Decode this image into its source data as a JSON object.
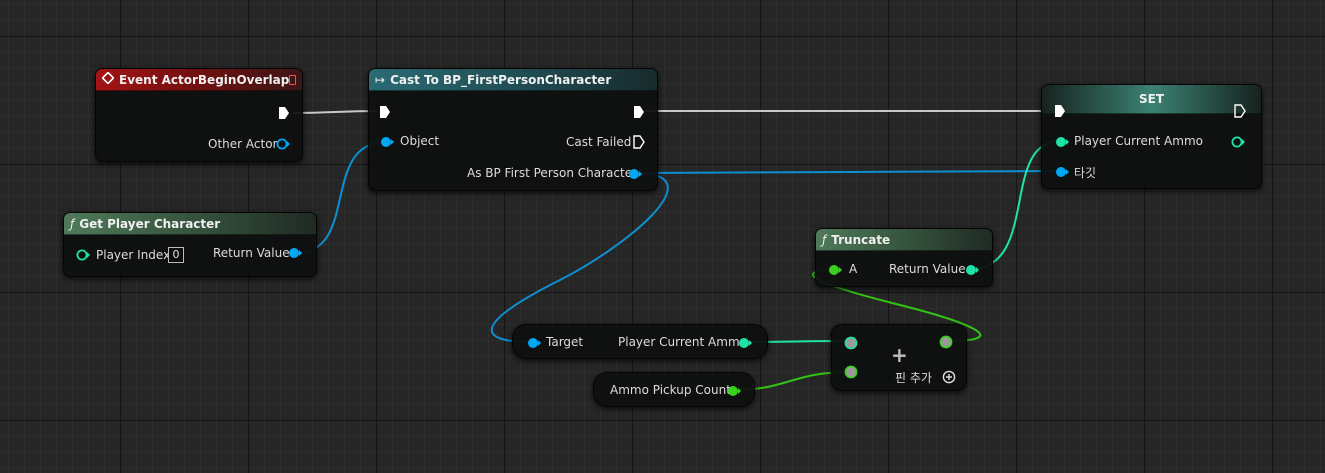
{
  "colors": {
    "exec": "#ffffff",
    "object": "#00a8f4",
    "integer": "#1ee3a8",
    "float": "#39d11c",
    "event_header": "#a41414",
    "function_header": "#4f7a5a",
    "cast_header": "#2b6a74",
    "set_header": "#3b8272"
  },
  "nodes": {
    "event": {
      "title": "Event ActorBeginOverlap",
      "other_actor": "Other Actor"
    },
    "get_player": {
      "icon": "ƒ",
      "title": "Get Player Character",
      "player_index": "Player Index",
      "index_value": "0",
      "return_value": "Return Value"
    },
    "cast": {
      "icon": "↦",
      "title": "Cast To BP_FirstPersonCharacter",
      "object": "Object",
      "cast_failed": "Cast Failed",
      "as_char": "As BP First Person Character"
    },
    "set": {
      "title": "SET",
      "player_current_ammo": "Player Current Ammo",
      "target": "타깃"
    },
    "truncate": {
      "icon": "ƒ",
      "title": "Truncate",
      "a": "A",
      "return_value": "Return Value"
    },
    "get_ammo": {
      "target": "Target",
      "player_current_ammo": "Player Current Ammo"
    },
    "ammo_pickup": {
      "label": "Ammo Pickup Count"
    },
    "add": {
      "symbol": "+",
      "add_pin": "핀 추가"
    }
  }
}
